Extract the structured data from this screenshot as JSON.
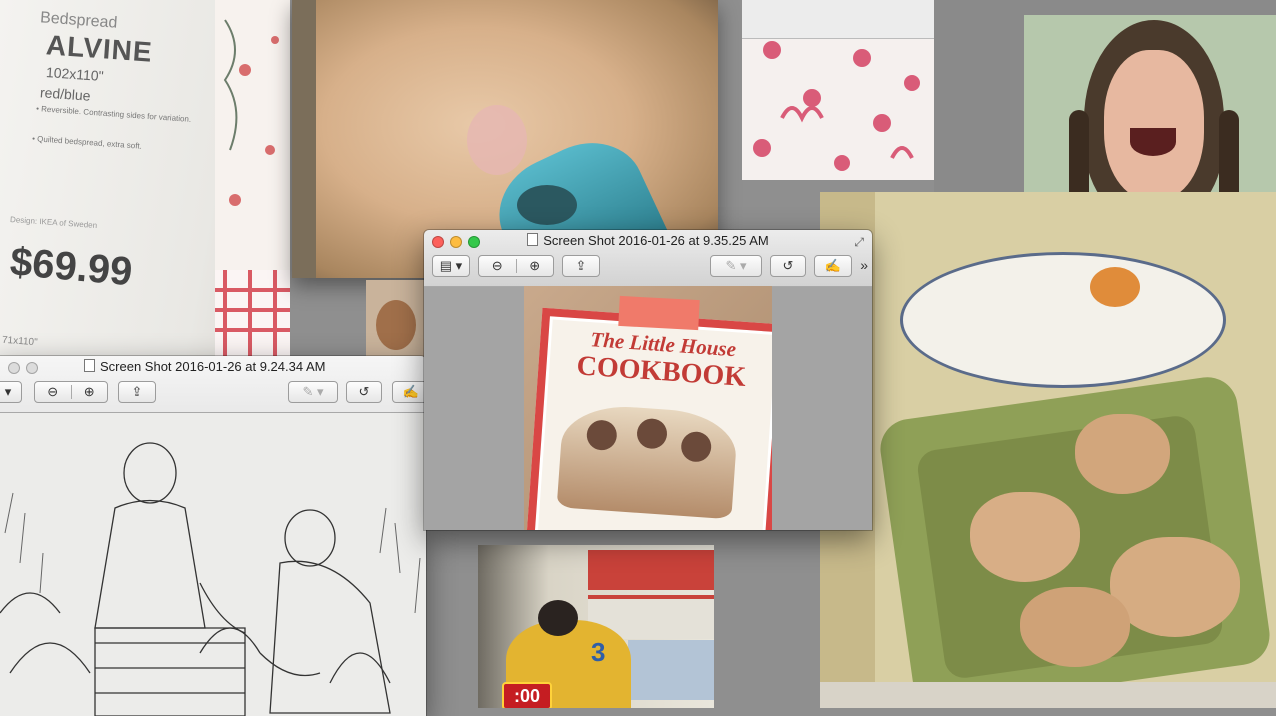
{
  "windows": {
    "front": {
      "title": "Screen Shot 2016-01-26 at 9.35.25 AM"
    },
    "back": {
      "title": "Screen Shot 2016-01-26 at 9.24.34 AM"
    }
  },
  "photos": {
    "price_tag": {
      "category": "Bedspread",
      "name": "ALVINE",
      "size": "102x110\"",
      "color": "red/blue",
      "bullet1": "• Reversible. Contrasting sides for variation.",
      "bullet2": "• Quilted bedspread, extra soft.",
      "designer": "Design: IKEA of Sweden",
      "price": "$69.99",
      "footer_size": "71x110\""
    },
    "cookbook": {
      "title_line1": "The Little House",
      "title_line2": "COOKBOOK"
    },
    "shopping": {
      "timer": ":00",
      "jersey_number": "3"
    }
  },
  "toolbar_icons": {
    "sidebar": "sidebar-view-icon",
    "zoom_out": "zoom-out-icon",
    "zoom_in": "zoom-in-icon",
    "share": "share-icon",
    "markup": "markup-pen-icon",
    "rotate": "rotate-icon",
    "annotate": "annotate-icon"
  }
}
